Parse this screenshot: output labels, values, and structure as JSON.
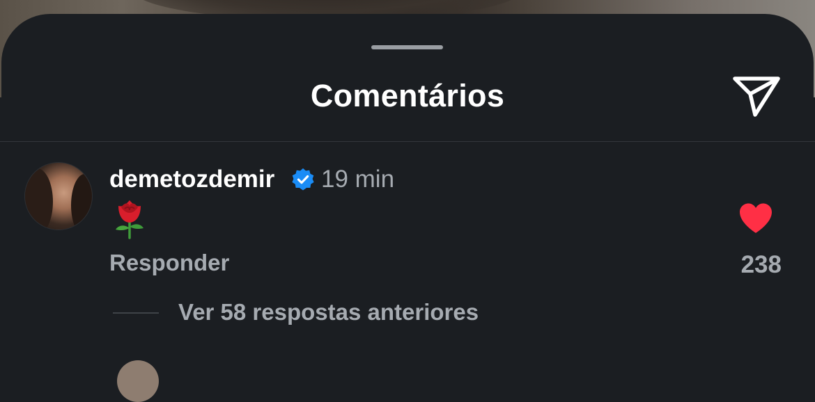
{
  "sheet": {
    "title": "Comentários"
  },
  "comment": {
    "username": "demetozdemir",
    "verified": true,
    "time": "19 min",
    "text": "🌹",
    "reply_label": "Responder",
    "like_count": "238",
    "liked": true,
    "view_replies_label": "Ver 58 respostas anteriores"
  },
  "icons": {
    "share": "paper-plane-icon",
    "verified": "verified-badge-icon",
    "like": "heart-icon",
    "comment_emoji": "rose"
  },
  "colors": {
    "background": "#1b1e22",
    "verified_blue": "#1a8cf6",
    "like_red": "#ff2f45",
    "secondary_text": "#a6abb1"
  }
}
